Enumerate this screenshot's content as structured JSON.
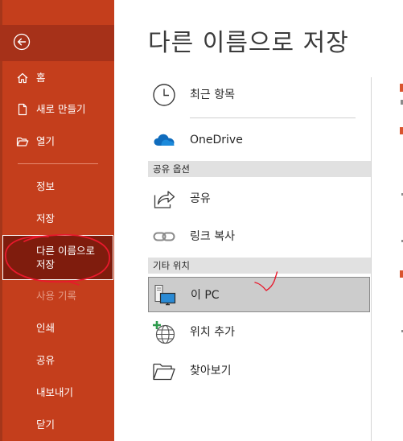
{
  "sidebar": {
    "back_icon": "back-arrow-circle-icon",
    "items": [
      {
        "label": "홈",
        "icon": "home-icon"
      },
      {
        "label": "새로 만들기",
        "icon": "new-document-icon"
      },
      {
        "label": "열기",
        "icon": "open-folder-icon"
      },
      {
        "label": "정보"
      },
      {
        "label": "저장"
      },
      {
        "label": "다른 이름으로\n저장",
        "selected": true
      },
      {
        "label": "사용 기록",
        "disabled": true
      },
      {
        "label": "인쇄"
      },
      {
        "label": "공유"
      },
      {
        "label": "내보내기"
      },
      {
        "label": "닫기"
      }
    ]
  },
  "main": {
    "title": "다른 이름으로 저장",
    "recent": {
      "label": "최근 항목",
      "icon": "clock-icon"
    },
    "onedrive": {
      "label": "OneDrive",
      "icon": "onedrive-cloud-icon"
    },
    "sections": [
      {
        "header": "공유 옵션",
        "items": [
          {
            "label": "공유",
            "icon": "share-arrow-icon"
          },
          {
            "label": "링크 복사",
            "icon": "link-icon"
          }
        ]
      },
      {
        "header": "기타 위치",
        "items": [
          {
            "label": "이 PC",
            "icon": "pc-icon",
            "selected": true
          },
          {
            "label": "위치 추가",
            "icon": "add-location-globe-icon"
          },
          {
            "label": "찾아보기",
            "icon": "folder-icon"
          }
        ]
      }
    ]
  },
  "colors": {
    "sidebar_bg": "#c43e1c",
    "sidebar_selected_bg": "#7f1c0d",
    "back_band": "#a63119",
    "section_header_bg": "#e1e1e1",
    "selected_location_bg": "#cccccc",
    "annotation_red": "#e8192c",
    "onedrive_blue": "#0f6cbd"
  }
}
